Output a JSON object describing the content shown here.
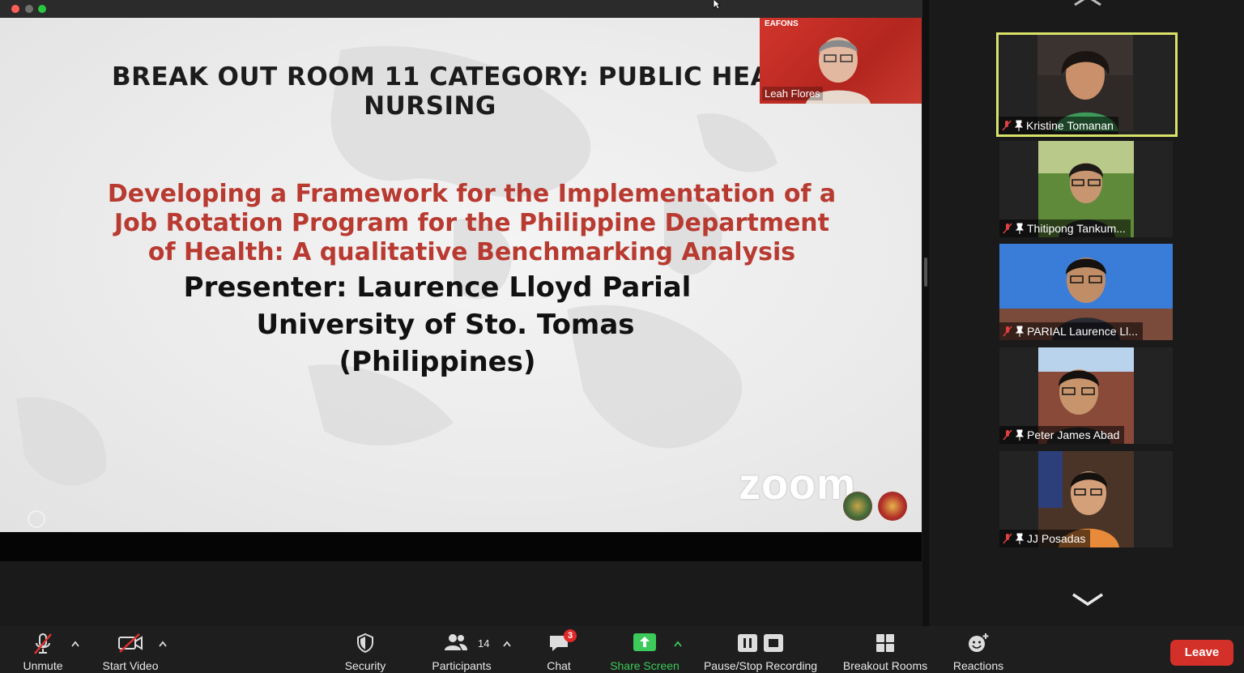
{
  "window": {
    "controls": [
      "close",
      "minimize",
      "zoom"
    ]
  },
  "slide": {
    "header_line1": "BREAK OUT ROOM 11 CATEGORY: PUBLIC HEA",
    "header_line2": "NURSING",
    "title_line1": "Developing a Framework for the Implementation of a",
    "title_line2": "Job Rotation Program for the Philippine Department",
    "title_line3": "of Health: A qualitative Benchmarking Analysis",
    "presenter_line1": "Presenter:  Laurence Lloyd Parial",
    "presenter_line2": "University of Sto. Tomas",
    "presenter_line3": "(Philippines)",
    "watermark": "zoom"
  },
  "speaker": {
    "banner": "EAFONS",
    "name": "Leah Flores"
  },
  "gallery": {
    "participants": [
      {
        "name": "Kristine Tomanan",
        "muted": true,
        "pinned": true,
        "active": true
      },
      {
        "name": "Thitipong Tankum...",
        "muted": true,
        "pinned": true,
        "active": false
      },
      {
        "name": "PARIAL Laurence Ll...",
        "muted": true,
        "pinned": true,
        "active": false
      },
      {
        "name": "Peter James Abad",
        "muted": true,
        "pinned": true,
        "active": false
      },
      {
        "name": "JJ Posadas",
        "muted": true,
        "pinned": true,
        "active": false
      }
    ]
  },
  "toolbar": {
    "unmute": "Unmute",
    "start_video": "Start Video",
    "security": "Security",
    "participants": "Participants",
    "participants_count": "14",
    "chat": "Chat",
    "chat_badge": "3",
    "share_screen": "Share Screen",
    "recording": "Pause/Stop Recording",
    "breakout": "Breakout Rooms",
    "reactions": "Reactions",
    "leave": "Leave"
  },
  "colors": {
    "active_speaker_border": "#d8e26a",
    "share_green": "#3ccb5a",
    "leave_red": "#d3302a",
    "title_red": "#b83a30"
  }
}
